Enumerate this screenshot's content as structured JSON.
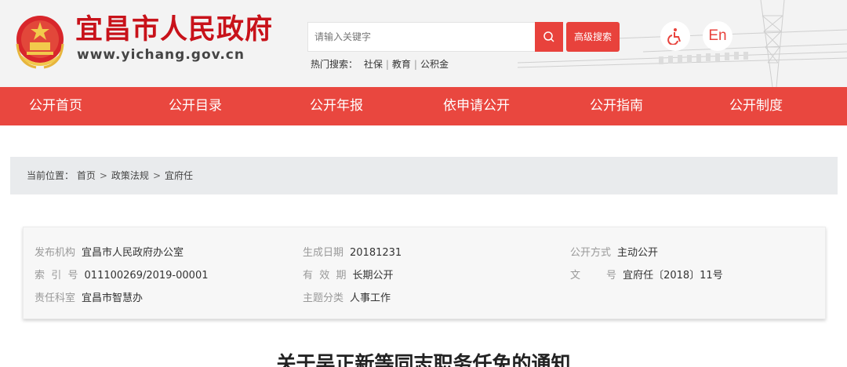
{
  "header": {
    "site_title": "宜昌市人民政府",
    "site_url": "www.yichang.gov.cn",
    "search_placeholder": "请输入关键字",
    "advanced_search": "高级搜索",
    "hot_label": "热门搜索：",
    "hot_terms": [
      "社保",
      "教育",
      "公积金"
    ],
    "lang_label": "En"
  },
  "nav": {
    "items": [
      "公开首页",
      "公开目录",
      "公开年报",
      "依申请公开",
      "公开指南",
      "公开制度"
    ]
  },
  "breadcrumb": {
    "label": "当前位置：",
    "items": [
      "首页",
      "政策法规",
      "宜府任"
    ]
  },
  "meta": {
    "publisher_label": "发布机构",
    "publisher": "宜昌市人民政府办公室",
    "date_label": "生成日期",
    "date": "20181231",
    "mode_label": "公开方式",
    "mode": "主动公开",
    "index_label": "索  引  号",
    "index": "011100269/2019-00001",
    "validity_label": "有  效  期",
    "validity": "长期公开",
    "docno_label": "文        号",
    "docno": "宜府任〔2018〕11号",
    "dept_label": "责任科室",
    "dept": "宜昌市智慧办",
    "topic_label": "主题分类",
    "topic": "人事工作"
  },
  "article": {
    "title": "关于吴正新等同志职务任免的通知"
  },
  "colors": {
    "brand_red": "#e9473f",
    "title_red": "#c8121a"
  }
}
